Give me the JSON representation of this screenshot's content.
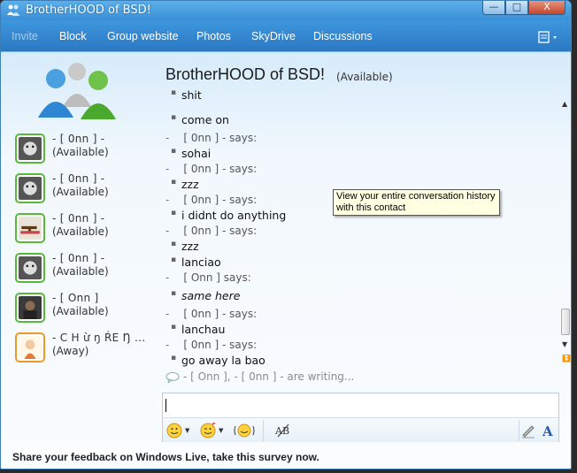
{
  "window": {
    "title": "BrotherHOOD of BSD!",
    "buttons": {
      "minimize": "—",
      "maximize": "□",
      "close": "X"
    }
  },
  "menu": {
    "items": [
      {
        "label": "Invite",
        "enabled": false
      },
      {
        "label": "Block",
        "enabled": true
      },
      {
        "label": "Group website",
        "enabled": true
      },
      {
        "label": "Photos",
        "enabled": true
      },
      {
        "label": "SkyDrive",
        "enabled": true
      },
      {
        "label": "Discussions",
        "enabled": true
      }
    ],
    "right_icon": "menu-options-icon"
  },
  "conversation": {
    "title": "BrotherHOOD of BSD!",
    "status": "(Available)"
  },
  "contacts": [
    {
      "name": "-      [ 0nn ]  -",
      "status": "(Available)",
      "state": "available",
      "avatar": "dog-avatar"
    },
    {
      "name": "-      [ 0nn ]  -",
      "status": "(Available)",
      "state": "available",
      "avatar": "dog-avatar"
    },
    {
      "name": "-      [ 0nn ]  -",
      "status": "(Available)",
      "state": "available",
      "avatar": "gun-avatar"
    },
    {
      "name": "-      [ 0nn ]  -",
      "status": "(Available)",
      "state": "available",
      "avatar": "dog-avatar"
    },
    {
      "name": "-      [ Onn ]",
      "status": "(Available)",
      "state": "available",
      "avatar": "photo-avatar"
    },
    {
      "name": "- C H ừ ŋ  ŔЕ Ŋ  ...",
      "status": "(Away)",
      "state": "away",
      "avatar": "cartoon-avatar"
    }
  ],
  "chat": [
    {
      "type": "msg",
      "text": "shit"
    },
    {
      "type": "msg",
      "text": "come on"
    },
    {
      "type": "says",
      "text": "[ 0nn ]   - says:"
    },
    {
      "type": "msg",
      "text": "sohai"
    },
    {
      "type": "says",
      "text": "[ 0nn ]   - says:"
    },
    {
      "type": "msg",
      "text": "zzz"
    },
    {
      "type": "says",
      "text": "[ 0nn ]   - says:"
    },
    {
      "type": "msg",
      "text": "i didnt do anything"
    },
    {
      "type": "says",
      "text": "[ 0nn ]   - says:"
    },
    {
      "type": "msg",
      "text": "zzz"
    },
    {
      "type": "msg",
      "text": "lanciao"
    },
    {
      "type": "says",
      "text": "[ Onn ] says:"
    },
    {
      "type": "msg",
      "text": "same here",
      "italic": true
    },
    {
      "type": "says",
      "text": "[ 0nn ]   - says:"
    },
    {
      "type": "msg",
      "text": "lanchau"
    },
    {
      "type": "says",
      "text": "[ 0nn ]   - says:"
    },
    {
      "type": "msg",
      "text": "go away la bao"
    }
  ],
  "tooltip": {
    "line1": "View your entire conversation history",
    "line2": "with this contact"
  },
  "typing_indicator": "-     [ Onn ], -       [ 0nn ]  - are writing...",
  "input": {
    "value": "",
    "toolbar": [
      "emoticon-icon",
      "wink-icon",
      "nudge-icon",
      "spell-check-icon",
      "handwriting-icon",
      "font-icon"
    ]
  },
  "footer": "Share your feedback on Windows Live, take this survey now.",
  "colors": {
    "titlebar": "#3a8fd6",
    "available": "#58b83a",
    "away": "#e89a2a",
    "tooltip_bg": "#ffffe1"
  }
}
